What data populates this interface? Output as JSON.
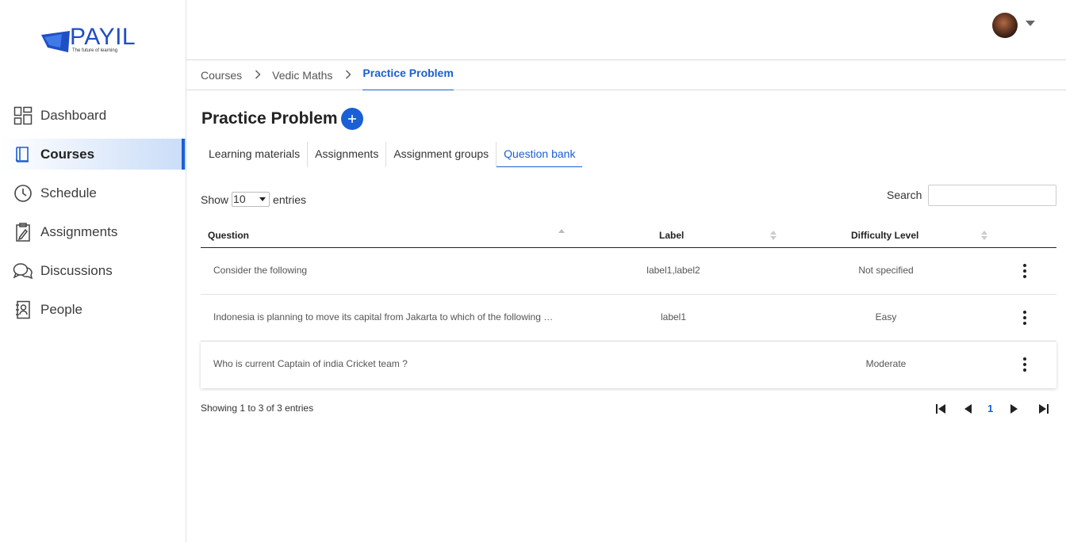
{
  "brand": {
    "name": "PAYIL",
    "tagline": "The future of learning",
    "color": "#1f4fc4"
  },
  "sidebar": {
    "items": [
      {
        "label": "Dashboard",
        "icon": "dashboard-icon"
      },
      {
        "label": "Courses",
        "icon": "book-icon",
        "active": true
      },
      {
        "label": "Schedule",
        "icon": "clock-icon"
      },
      {
        "label": "Assignments",
        "icon": "clipboard-icon"
      },
      {
        "label": "Discussions",
        "icon": "chat-bubbles-icon"
      },
      {
        "label": "People",
        "icon": "contact-book-icon"
      }
    ]
  },
  "topbar": {
    "avatar": "user-avatar",
    "menu_icon": "caret-down-icon"
  },
  "breadcrumb": [
    "Courses",
    "Vedic Maths",
    "Practice Problem"
  ],
  "page": {
    "title": "Practice Problem",
    "add_icon": "plus-icon"
  },
  "tabs": [
    {
      "label": "Learning materials"
    },
    {
      "label": "Assignments"
    },
    {
      "label": "Assignment groups"
    },
    {
      "label": "Question bank",
      "active": true
    }
  ],
  "entries": {
    "show_label": "Show",
    "value": "10",
    "suffix": "entries"
  },
  "search": {
    "label": "Search",
    "value": ""
  },
  "table": {
    "headers": {
      "question": "Question",
      "label": "Label",
      "difficulty": "Difficulty Level"
    },
    "rows": [
      {
        "question": "Consider the following",
        "label": "label1,label2",
        "difficulty": "Not specified"
      },
      {
        "question": "Indonesia is planning to move its capital from Jakarta to which of the following cities?",
        "label": "label1",
        "difficulty": "Easy"
      },
      {
        "question": "Who is current Captain of india Cricket team ?",
        "label": "",
        "difficulty": "Moderate"
      }
    ]
  },
  "footer": {
    "info": "Showing 1 to 3 of 3 entries",
    "current_page": "1"
  },
  "colors": {
    "accent": "#1a5fd4",
    "active_gradient_end": "#c9dcf8"
  }
}
